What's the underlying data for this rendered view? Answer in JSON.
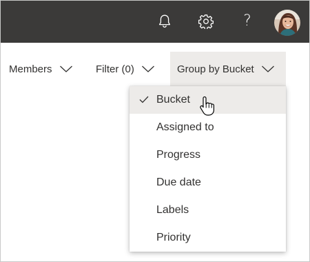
{
  "header": {
    "icons": [
      "bell-icon",
      "gear-icon",
      "help-icon"
    ],
    "help_glyph": "?",
    "colors": {
      "background": "#3b3a39",
      "icon": "#ffffff"
    }
  },
  "toolbar": {
    "members_label": "Members",
    "filter_label": "Filter (0)",
    "group_label": "Group by Bucket"
  },
  "group_menu": {
    "selected": "Bucket",
    "items": [
      {
        "label": "Bucket",
        "checked": true
      },
      {
        "label": "Assigned to",
        "checked": false
      },
      {
        "label": "Progress",
        "checked": false
      },
      {
        "label": "Due date",
        "checked": false
      },
      {
        "label": "Labels",
        "checked": false
      },
      {
        "label": "Priority",
        "checked": false
      }
    ],
    "colors": {
      "selected_bg": "#edebe9",
      "text": "#323130"
    }
  }
}
